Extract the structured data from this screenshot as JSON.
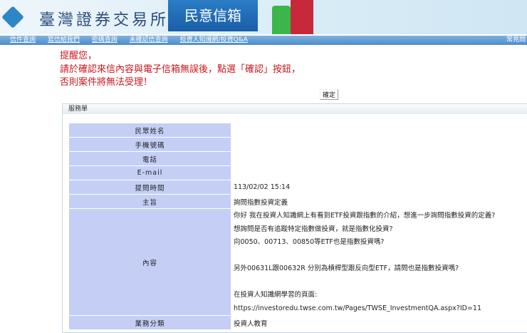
{
  "header": {
    "org_name": "臺灣證券交易所",
    "mailbox_title": "民意信箱"
  },
  "nav": {
    "items": [
      "信件查詢",
      "寫信給我們",
      "密碼查詢",
      "未確認信查詢",
      "投資人知識網/投資Q&A"
    ],
    "right": "常見問"
  },
  "notice": [
    "提醒您，",
    "請於確認來信內容與電子信箱無誤後，點選「確認」按鈕，",
    "否則案件將無法受理！"
  ],
  "confirm_label": "確定",
  "panel_title": "服務單",
  "form": [
    {
      "label": "民眾姓名",
      "value": ""
    },
    {
      "label": "手機號碼",
      "value": ""
    },
    {
      "label": "電話",
      "value": ""
    },
    {
      "label": "E-mail",
      "value": ""
    },
    {
      "label": "提問時間",
      "value": "113/02/02 15:14"
    },
    {
      "label": "主旨",
      "value": "詢問指數投資定義"
    }
  ],
  "content_label": "內容",
  "content_lines": [
    "你好 我在投資人知識網上有看到ETF投資跟指數的介紹，想進一步詢問指數投資的定義?",
    "想詢問是否有追蹤特定指數做投資，就是指數化投資?",
    "向0050、00713、00850等ETF也是指數投資嗎?",
    "",
    "另外00631L跟00632R 分別為槓桿型跟反向型ETF，請問也是指數投資嗎?",
    "",
    "在投資人知識網學習的頁面:",
    "https://investoredu.twse.com.tw/Pages/TWSE_InvestmentQA.aspx?ID=11"
  ],
  "category": {
    "label": "業務分類",
    "value": "投資人教育"
  }
}
